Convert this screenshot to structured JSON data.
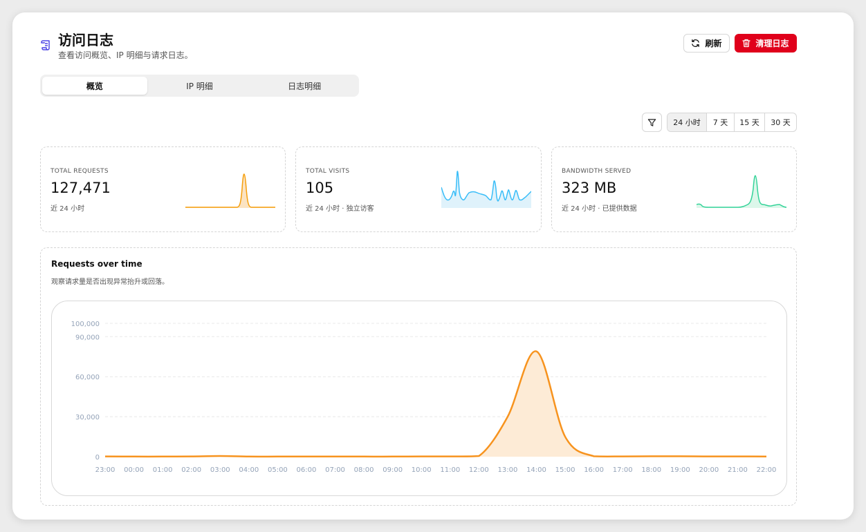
{
  "header": {
    "icon": "scroll-icon",
    "title": "访问日志",
    "subtitle": "查看访问概览、IP 明细与请求日志。",
    "refresh_label": "刷新",
    "clear_label": "清理日志"
  },
  "tabs": [
    {
      "label": "概览",
      "active": true
    },
    {
      "label": "IP 明细",
      "active": false
    },
    {
      "label": "日志明细",
      "active": false
    }
  ],
  "range": {
    "options": [
      {
        "label": "24 小时",
        "active": true
      },
      {
        "label": "7 天",
        "active": false
      },
      {
        "label": "15 天",
        "active": false
      },
      {
        "label": "30 天",
        "active": false
      }
    ]
  },
  "cards": [
    {
      "label": "TOTAL REQUESTS",
      "value": "127,471",
      "sub": "近 24 小时",
      "color": "#f59e0b",
      "fill": "#fbe3c2"
    },
    {
      "label": "TOTAL VISITS",
      "value": "105",
      "sub": "近 24 小时 · 独立访客",
      "color": "#38bdf8",
      "fill": "#dff2fb"
    },
    {
      "label": "BANDWIDTH SERVED",
      "value": "323 MB",
      "sub": "近 24 小时 · 已提供数据",
      "color": "#34d399",
      "fill": "#dcf7ea"
    }
  ],
  "chart": {
    "title": "Requests over time",
    "subtitle": "观察请求量是否出现异常抬升或回落。"
  },
  "chart_data": {
    "type": "area",
    "x": [
      "23:00",
      "00:00",
      "01:00",
      "02:00",
      "03:00",
      "04:00",
      "05:00",
      "06:00",
      "07:00",
      "08:00",
      "09:00",
      "10:00",
      "11:00",
      "12:00",
      "13:00",
      "14:00",
      "15:00",
      "16:00",
      "17:00",
      "18:00",
      "19:00",
      "20:00",
      "21:00",
      "22:00"
    ],
    "values": [
      200,
      100,
      100,
      200,
      500,
      100,
      100,
      100,
      100,
      100,
      100,
      200,
      200,
      500,
      30000,
      79000,
      15000,
      300,
      200,
      300,
      300,
      200,
      200,
      100
    ],
    "yticks": [
      0,
      30000,
      60000,
      90000,
      100000
    ],
    "ytick_labels": [
      "0",
      "30,000",
      "60,000",
      "90,000",
      "100,000"
    ],
    "ylim": [
      0,
      100000
    ],
    "grid": true,
    "series_color": "#f7931e",
    "fill_color": "#fdebd6"
  }
}
